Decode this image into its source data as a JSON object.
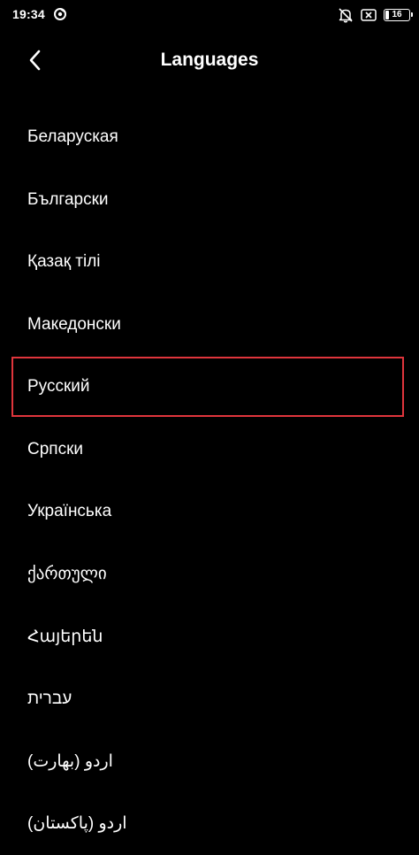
{
  "status_bar": {
    "time": "19:34",
    "battery_level": "16"
  },
  "header": {
    "title": "Languages"
  },
  "languages": [
    "Беларуская",
    "Български",
    "Қазақ тілі",
    "Македонски",
    "Русский",
    "Српски",
    "Українська",
    "ქართული",
    "Հայերեն",
    "עברית",
    "اردو (بھارت)",
    "اردو (پاکستان)"
  ],
  "highlighted_language": "Русский",
  "colors": {
    "background": "#000000",
    "text": "#ffffff",
    "highlight_border": "#e0353c"
  }
}
